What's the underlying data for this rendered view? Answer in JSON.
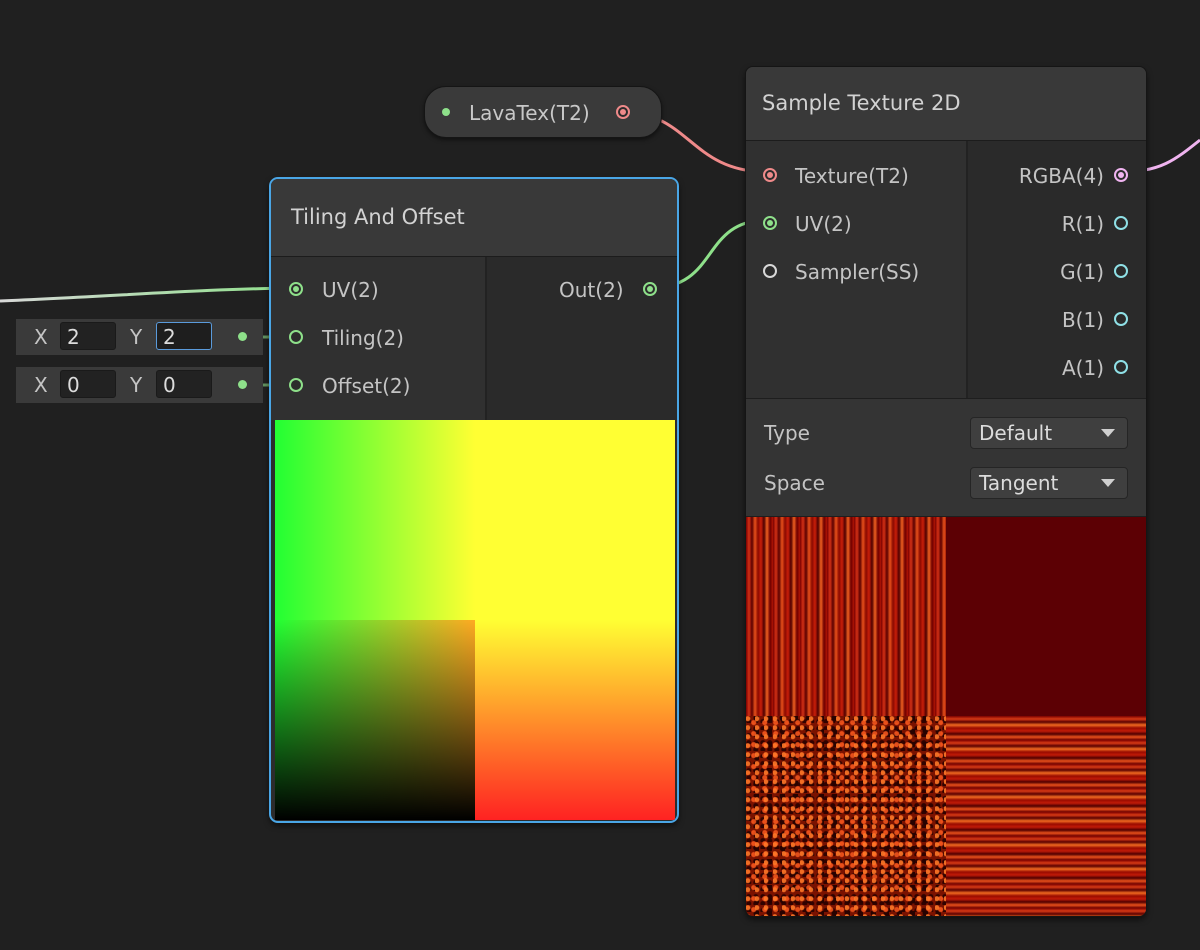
{
  "property_node": {
    "label": "LavaTex(T2)",
    "port_color": "#ef8a8a"
  },
  "tiling_node": {
    "title": "Tiling And Offset",
    "inputs": [
      {
        "label": "UV(2)"
      },
      {
        "label": "Tiling(2)"
      },
      {
        "label": "Offset(2)"
      }
    ],
    "outputs": [
      {
        "label": "Out(2)"
      }
    ],
    "tiling_field": {
      "x_label": "X",
      "x": "2",
      "y_label": "Y",
      "y": "2"
    },
    "offset_field": {
      "x_label": "X",
      "x": "0",
      "y_label": "Y",
      "y": "0"
    },
    "selected_border": "#4aa6e6"
  },
  "sample_node": {
    "title": "Sample Texture 2D",
    "inputs": [
      {
        "label": "Texture(T2)"
      },
      {
        "label": "UV(2)"
      },
      {
        "label": "Sampler(SS)"
      }
    ],
    "outputs": [
      {
        "label": "RGBA(4)"
      },
      {
        "label": "R(1)"
      },
      {
        "label": "G(1)"
      },
      {
        "label": "B(1)"
      },
      {
        "label": "A(1)"
      }
    ],
    "settings": {
      "type_label": "Type",
      "type_value": "Default",
      "space_label": "Space",
      "space_value": "Tangent"
    }
  },
  "colors": {
    "canvas_bg": "#202020",
    "vector2_port": "#8ee08a",
    "texture_port": "#ef8a8a",
    "vector4_port": "#f0b4f0",
    "vector1_port": "#8fe0e6"
  }
}
